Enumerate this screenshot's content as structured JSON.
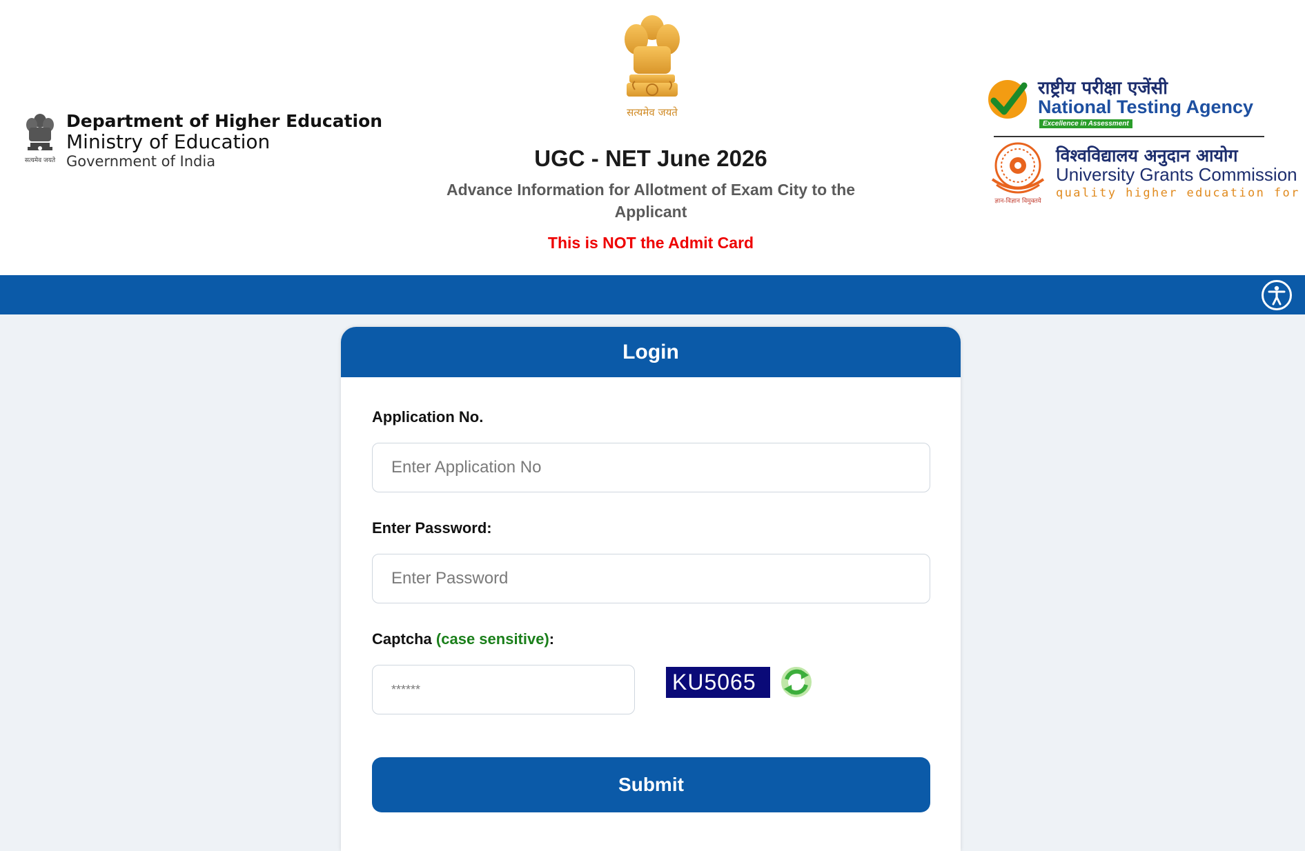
{
  "header": {
    "department": {
      "line1": "Department of Higher Education",
      "line2": "Ministry of Education",
      "line3": "Government of India",
      "emblem_caption": "सत्यमेव जयते"
    },
    "center_emblem_caption": "सत्यमेव जयते",
    "title": "UGC - NET June 2026",
    "subtitle": "Advance Information for Allotment of Exam City to the Applicant",
    "warning": "This is NOT the Admit Card",
    "nta": {
      "hindi": "राष्ट्रीय परीक्षा एजेंसी",
      "english": "National Testing Agency",
      "tagline": "Excellence in Assessment"
    },
    "ugc": {
      "hindi": "विश्वविद्यालय अनुदान आयोग",
      "english": "University Grants Commission",
      "motto": "quality higher education for all",
      "emblem_caption": "ज्ञान-विज्ञान विमुक्तये"
    }
  },
  "toolbar": {
    "accessibility_icon": "accessibility-icon"
  },
  "login": {
    "title": "Login",
    "application_label": "Application No.",
    "application_placeholder": "Enter Application No",
    "application_value": "",
    "password_label": "Enter Password:",
    "password_placeholder": "Enter Password",
    "password_value": "",
    "captcha_label": "Captcha",
    "captcha_note": "(case sensitive)",
    "captcha_colon": ":",
    "captcha_placeholder": "******",
    "captcha_value": "",
    "captcha_text": "KU5065",
    "refresh_icon": "refresh-icon",
    "submit_label": "Submit"
  },
  "colors": {
    "primary_blue": "#0b5aa8",
    "warning_red": "#ee0000",
    "captcha_bg": "#0a0a78",
    "note_green": "#1a7f1a"
  }
}
